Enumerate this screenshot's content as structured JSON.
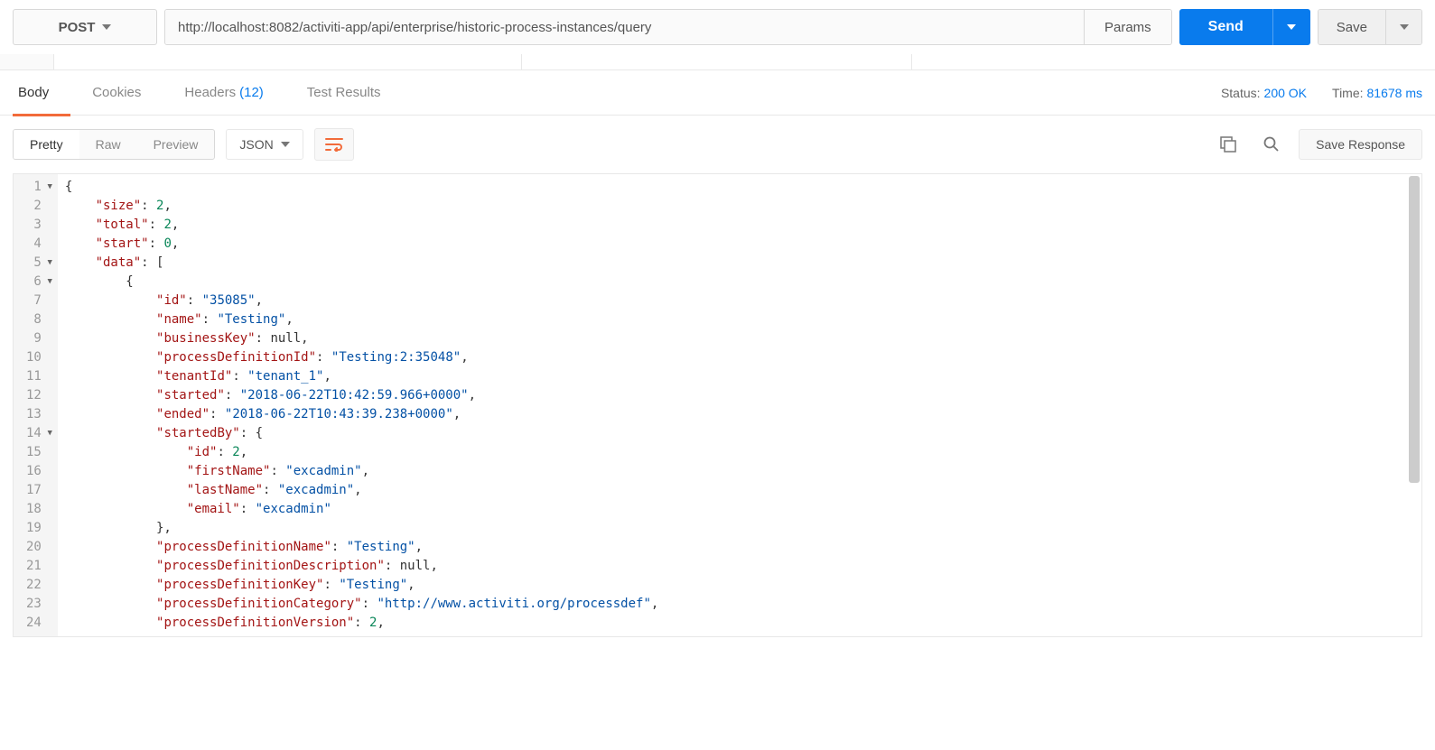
{
  "request": {
    "method": "POST",
    "url": "http://localhost:8082/activiti-app/api/enterprise/historic-process-instances/query",
    "params_label": "Params",
    "send_label": "Send",
    "save_label": "Save"
  },
  "response_tabs": {
    "body": "Body",
    "cookies": "Cookies",
    "headers": "Headers",
    "headers_count": "(12)",
    "tests": "Test Results"
  },
  "status": {
    "label": "Status:",
    "value": "200 OK",
    "time_label": "Time:",
    "time_value": "81678 ms"
  },
  "view": {
    "pretty": "Pretty",
    "raw": "Raw",
    "preview": "Preview",
    "syntax": "JSON",
    "save_response": "Save Response"
  },
  "code": {
    "line_numbers": [
      "1",
      "2",
      "3",
      "4",
      "5",
      "6",
      "7",
      "8",
      "9",
      "10",
      "11",
      "12",
      "13",
      "14",
      "15",
      "16",
      "17",
      "18",
      "19",
      "20",
      "21",
      "22",
      "23",
      "24"
    ],
    "foldable": [
      true,
      false,
      false,
      false,
      true,
      true,
      false,
      false,
      false,
      false,
      false,
      false,
      false,
      true,
      false,
      false,
      false,
      false,
      false,
      false,
      false,
      false,
      false,
      false
    ],
    "lines": [
      [
        {
          "t": "{",
          "c": "p"
        }
      ],
      [
        {
          "t": "    ",
          "c": "p"
        },
        {
          "t": "\"size\"",
          "c": "k"
        },
        {
          "t": ": ",
          "c": "p"
        },
        {
          "t": "2",
          "c": "n"
        },
        {
          "t": ",",
          "c": "p"
        }
      ],
      [
        {
          "t": "    ",
          "c": "p"
        },
        {
          "t": "\"total\"",
          "c": "k"
        },
        {
          "t": ": ",
          "c": "p"
        },
        {
          "t": "2",
          "c": "n"
        },
        {
          "t": ",",
          "c": "p"
        }
      ],
      [
        {
          "t": "    ",
          "c": "p"
        },
        {
          "t": "\"start\"",
          "c": "k"
        },
        {
          "t": ": ",
          "c": "p"
        },
        {
          "t": "0",
          "c": "n"
        },
        {
          "t": ",",
          "c": "p"
        }
      ],
      [
        {
          "t": "    ",
          "c": "p"
        },
        {
          "t": "\"data\"",
          "c": "k"
        },
        {
          "t": ": [",
          "c": "p"
        }
      ],
      [
        {
          "t": "        {",
          "c": "p"
        }
      ],
      [
        {
          "t": "            ",
          "c": "p"
        },
        {
          "t": "\"id\"",
          "c": "k"
        },
        {
          "t": ": ",
          "c": "p"
        },
        {
          "t": "\"35085\"",
          "c": "s"
        },
        {
          "t": ",",
          "c": "p"
        }
      ],
      [
        {
          "t": "            ",
          "c": "p"
        },
        {
          "t": "\"name\"",
          "c": "k"
        },
        {
          "t": ": ",
          "c": "p"
        },
        {
          "t": "\"Testing\"",
          "c": "s"
        },
        {
          "t": ",",
          "c": "p"
        }
      ],
      [
        {
          "t": "            ",
          "c": "p"
        },
        {
          "t": "\"businessKey\"",
          "c": "k"
        },
        {
          "t": ": ",
          "c": "p"
        },
        {
          "t": "null",
          "c": "null"
        },
        {
          "t": ",",
          "c": "p"
        }
      ],
      [
        {
          "t": "            ",
          "c": "p"
        },
        {
          "t": "\"processDefinitionId\"",
          "c": "k"
        },
        {
          "t": ": ",
          "c": "p"
        },
        {
          "t": "\"Testing:2:35048\"",
          "c": "s"
        },
        {
          "t": ",",
          "c": "p"
        }
      ],
      [
        {
          "t": "            ",
          "c": "p"
        },
        {
          "t": "\"tenantId\"",
          "c": "k"
        },
        {
          "t": ": ",
          "c": "p"
        },
        {
          "t": "\"tenant_1\"",
          "c": "s"
        },
        {
          "t": ",",
          "c": "p"
        }
      ],
      [
        {
          "t": "            ",
          "c": "p"
        },
        {
          "t": "\"started\"",
          "c": "k"
        },
        {
          "t": ": ",
          "c": "p"
        },
        {
          "t": "\"2018-06-22T10:42:59.966+0000\"",
          "c": "s"
        },
        {
          "t": ",",
          "c": "p"
        }
      ],
      [
        {
          "t": "            ",
          "c": "p"
        },
        {
          "t": "\"ended\"",
          "c": "k"
        },
        {
          "t": ": ",
          "c": "p"
        },
        {
          "t": "\"2018-06-22T10:43:39.238+0000\"",
          "c": "s"
        },
        {
          "t": ",",
          "c": "p"
        }
      ],
      [
        {
          "t": "            ",
          "c": "p"
        },
        {
          "t": "\"startedBy\"",
          "c": "k"
        },
        {
          "t": ": {",
          "c": "p"
        }
      ],
      [
        {
          "t": "                ",
          "c": "p"
        },
        {
          "t": "\"id\"",
          "c": "k"
        },
        {
          "t": ": ",
          "c": "p"
        },
        {
          "t": "2",
          "c": "n"
        },
        {
          "t": ",",
          "c": "p"
        }
      ],
      [
        {
          "t": "                ",
          "c": "p"
        },
        {
          "t": "\"firstName\"",
          "c": "k"
        },
        {
          "t": ": ",
          "c": "p"
        },
        {
          "t": "\"excadmin\"",
          "c": "s"
        },
        {
          "t": ",",
          "c": "p"
        }
      ],
      [
        {
          "t": "                ",
          "c": "p"
        },
        {
          "t": "\"lastName\"",
          "c": "k"
        },
        {
          "t": ": ",
          "c": "p"
        },
        {
          "t": "\"excadmin\"",
          "c": "s"
        },
        {
          "t": ",",
          "c": "p"
        }
      ],
      [
        {
          "t": "                ",
          "c": "p"
        },
        {
          "t": "\"email\"",
          "c": "k"
        },
        {
          "t": ": ",
          "c": "p"
        },
        {
          "t": "\"excadmin\"",
          "c": "s"
        }
      ],
      [
        {
          "t": "            },",
          "c": "p"
        }
      ],
      [
        {
          "t": "            ",
          "c": "p"
        },
        {
          "t": "\"processDefinitionName\"",
          "c": "k"
        },
        {
          "t": ": ",
          "c": "p"
        },
        {
          "t": "\"Testing\"",
          "c": "s"
        },
        {
          "t": ",",
          "c": "p"
        }
      ],
      [
        {
          "t": "            ",
          "c": "p"
        },
        {
          "t": "\"processDefinitionDescription\"",
          "c": "k"
        },
        {
          "t": ": ",
          "c": "p"
        },
        {
          "t": "null",
          "c": "null"
        },
        {
          "t": ",",
          "c": "p"
        }
      ],
      [
        {
          "t": "            ",
          "c": "p"
        },
        {
          "t": "\"processDefinitionKey\"",
          "c": "k"
        },
        {
          "t": ": ",
          "c": "p"
        },
        {
          "t": "\"Testing\"",
          "c": "s"
        },
        {
          "t": ",",
          "c": "p"
        }
      ],
      [
        {
          "t": "            ",
          "c": "p"
        },
        {
          "t": "\"processDefinitionCategory\"",
          "c": "k"
        },
        {
          "t": ": ",
          "c": "p"
        },
        {
          "t": "\"http://www.activiti.org/processdef\"",
          "c": "s"
        },
        {
          "t": ",",
          "c": "p"
        }
      ],
      [
        {
          "t": "            ",
          "c": "p"
        },
        {
          "t": "\"processDefinitionVersion\"",
          "c": "k"
        },
        {
          "t": ": ",
          "c": "p"
        },
        {
          "t": "2",
          "c": "n"
        },
        {
          "t": ",",
          "c": "p"
        }
      ]
    ]
  }
}
